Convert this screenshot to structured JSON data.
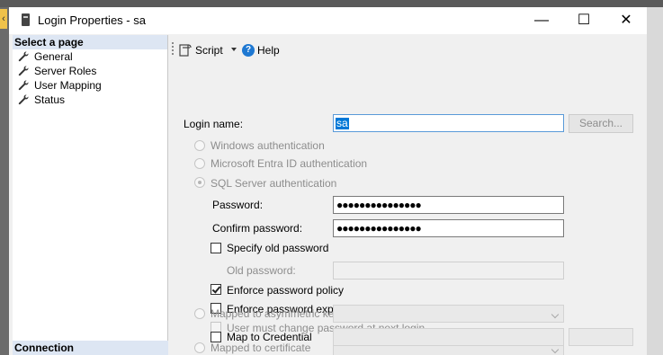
{
  "window": {
    "title": "Login Properties - sa",
    "minimize_glyph": "—",
    "maximize_glyph": "☐",
    "close_glyph": "✕"
  },
  "sidebar": {
    "select_page_heading": "Select a page",
    "items": [
      {
        "label": "General",
        "icon": "wrench-icon"
      },
      {
        "label": "Server Roles",
        "icon": "wrench-icon"
      },
      {
        "label": "User Mapping",
        "icon": "wrench-icon"
      },
      {
        "label": "Status",
        "icon": "wrench-icon"
      }
    ],
    "connection_heading": "Connection"
  },
  "toolbar": {
    "script_label": "Script",
    "help_label": "Help",
    "help_icon_glyph": "?"
  },
  "general": {
    "login_name_label": "Login name:",
    "login_name_value": "sa",
    "search_label": "Search...",
    "auth_options": [
      "Windows authentication",
      "Microsoft Entra ID authentication",
      "SQL Server authentication"
    ],
    "selected_auth": "SQL Server authentication",
    "password_label": "Password:",
    "password_value": "●●●●●●●●●●●●●●●",
    "confirm_password_label": "Confirm password:",
    "confirm_password_value": "●●●●●●●●●●●●●●●",
    "specify_old_password_label": "Specify old password",
    "specify_old_password_checked": false,
    "old_password_label": "Old password:",
    "enforce_policy_label": "Enforce password policy",
    "enforce_policy_checked": true,
    "enforce_expiration_label": "Enforce password expiration",
    "enforce_expiration_checked": false,
    "must_change_label": "User must change password at next login",
    "must_change_checked": false,
    "mapped_certificate_label": "Mapped to certificate",
    "mapped_asym_key_label": "Mapped to asymmetric key",
    "map_credential_label": "Map to Credential"
  }
}
